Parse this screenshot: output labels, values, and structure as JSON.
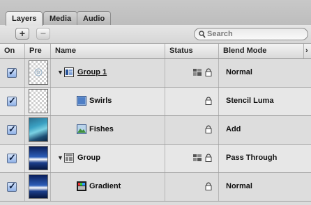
{
  "tabs": [
    {
      "label": "Layers",
      "active": true
    },
    {
      "label": "Media",
      "active": false
    },
    {
      "label": "Audio",
      "active": false
    }
  ],
  "toolbar": {
    "add_label": "+",
    "remove_label": "−",
    "search_placeholder": "Search"
  },
  "columns": {
    "on": "On",
    "pre": "Pre",
    "name": "Name",
    "status": "Status",
    "blend": "Blend Mode",
    "more": "›"
  },
  "layers": [
    {
      "name": "Group 1",
      "blend": "Normal",
      "on": true,
      "kind": "group",
      "expanded": true,
      "icons": [
        "grid-icon",
        "lock-icon"
      ],
      "preview": "checker-swirl"
    },
    {
      "name": "Swirls",
      "blend": "Stencil Luma",
      "on": true,
      "kind": "image",
      "icons": [
        "lock-icon"
      ],
      "preview": "checker"
    },
    {
      "name": "Fishes",
      "blend": "Add",
      "on": true,
      "kind": "image",
      "icons": [
        "lock-icon"
      ],
      "preview": "fishes"
    },
    {
      "name": "Group",
      "blend": "Pass Through",
      "on": true,
      "kind": "group",
      "expanded": true,
      "icons": [
        "grid-icon",
        "lock-icon"
      ],
      "preview": "blue-gradient"
    },
    {
      "name": "Gradient",
      "blend": "Normal",
      "on": true,
      "kind": "gradient",
      "icons": [
        "lock-icon"
      ],
      "preview": "blue-gradient"
    }
  ],
  "colors": {
    "panel": "#dcdcdc",
    "check": "#8fb1e6"
  }
}
